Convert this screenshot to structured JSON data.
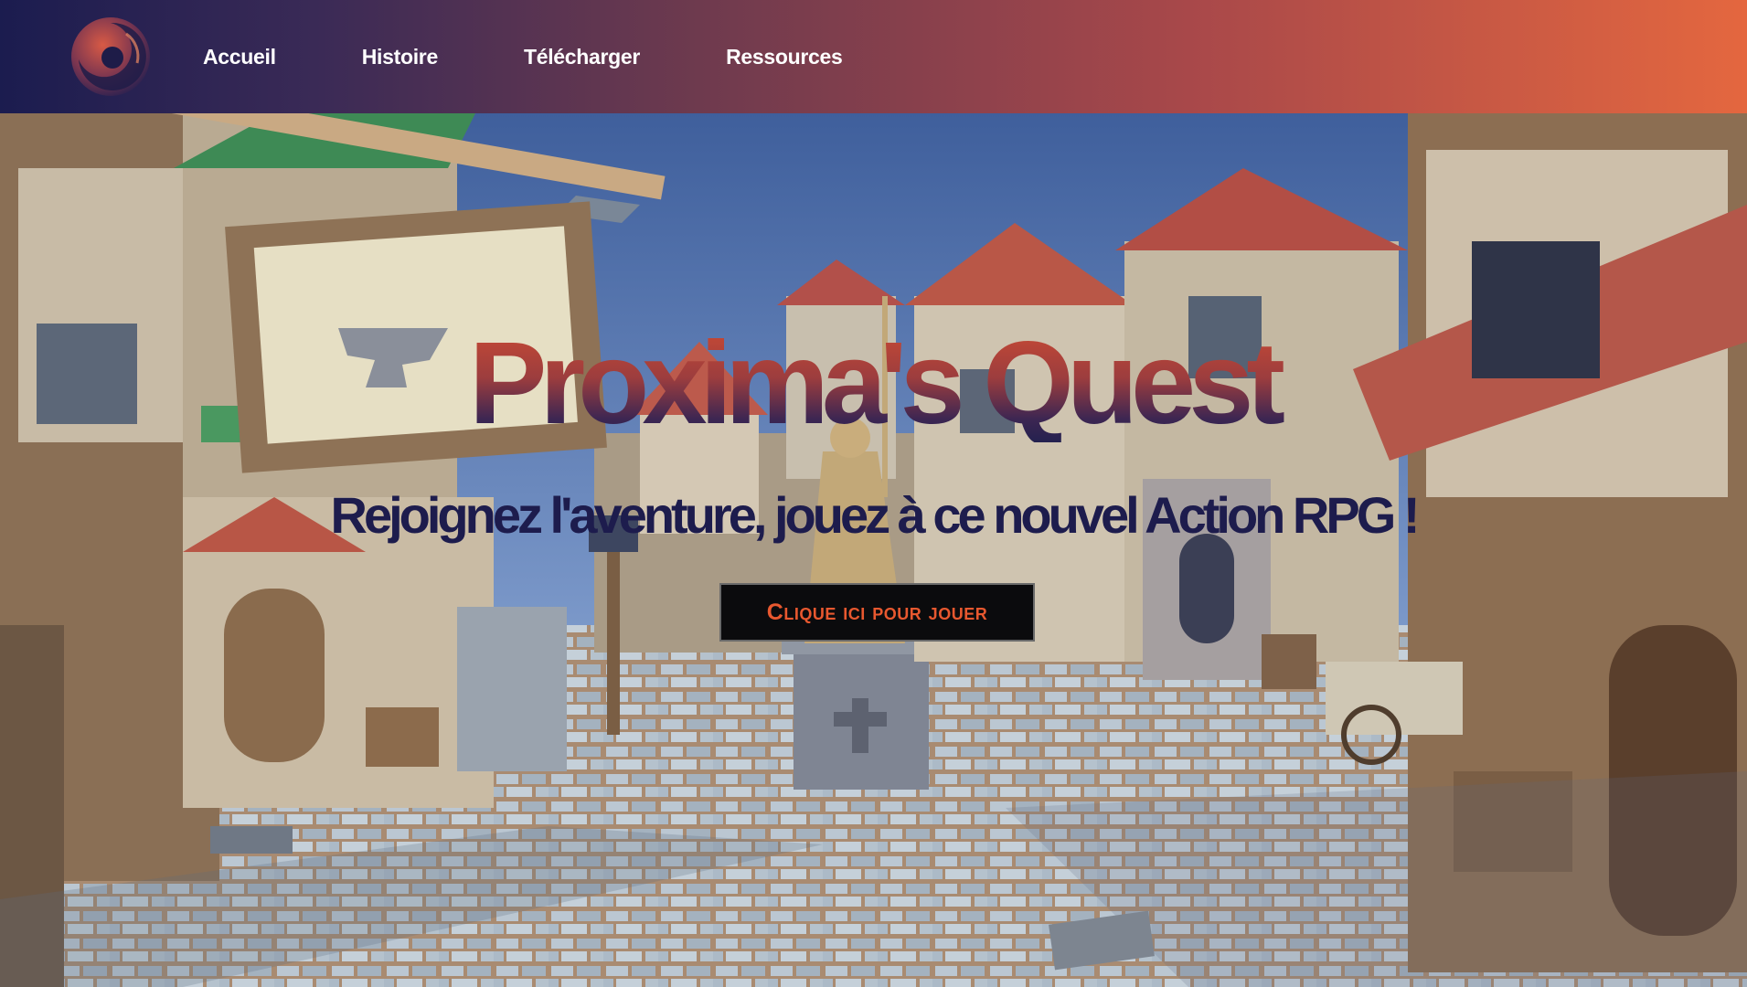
{
  "nav": {
    "logo_icon": "proxima-orb-logo-icon",
    "links": [
      {
        "label": "Accueil"
      },
      {
        "label": "Histoire"
      },
      {
        "label": "Télécharger"
      },
      {
        "label": "Ressources"
      }
    ]
  },
  "hero": {
    "title": "Proxima's Quest",
    "subtitle": "Rejoignez l'aventure, jouez à ce nouvel Action RPG !",
    "cta_label": "Clique ici pour jouer",
    "background_scene": "low-poly-medieval-village-square"
  },
  "colors": {
    "nav_gradient_start": "#1b1c4f",
    "nav_gradient_end": "#e4673f",
    "title_top": "#c94a34",
    "title_bottom": "#24214f",
    "subtitle": "#1d1c4d",
    "cta_text": "#e8582f",
    "cta_bg": "#0b0b0d"
  }
}
